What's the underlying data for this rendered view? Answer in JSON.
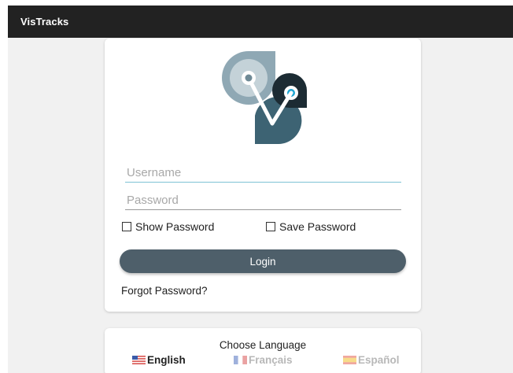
{
  "app": {
    "title": "VisTracks"
  },
  "login": {
    "username_placeholder": "Username",
    "password_placeholder": "Password",
    "show_password_label": "Show Password",
    "save_password_label": "Save Password",
    "login_button": "Login",
    "forgot_password": "Forgot Password?"
  },
  "language": {
    "title": "Choose Language",
    "options": [
      {
        "label": "English",
        "selected": true,
        "icon": "us-flag-icon"
      },
      {
        "label": "Français",
        "selected": false,
        "icon": "fr-flag-icon"
      },
      {
        "label": "Español",
        "selected": false,
        "icon": "es-flag-icon"
      }
    ]
  },
  "colors": {
    "topbar": "#222222",
    "login_button": "#4e5f6a",
    "logo_light": "#8fa8b4",
    "logo_dark": "#2f4f5f",
    "accent": "#1ea6d3"
  }
}
